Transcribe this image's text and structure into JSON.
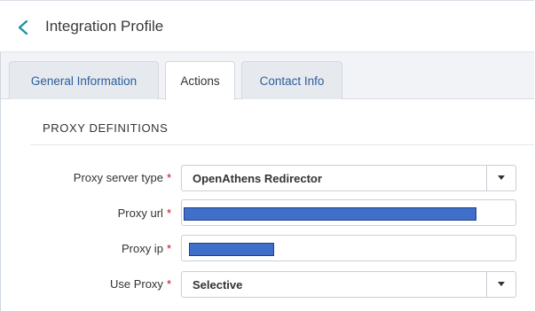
{
  "header": {
    "title": "Integration Profile"
  },
  "tabs": [
    {
      "label": "General Information",
      "active": false
    },
    {
      "label": "Actions",
      "active": true
    },
    {
      "label": "Contact Info",
      "active": false
    }
  ],
  "section": {
    "title": "PROXY DEFINITIONS"
  },
  "form": {
    "proxy_server_type": {
      "label": "Proxy server type",
      "value": "OpenAthens Redirector"
    },
    "proxy_url": {
      "label": "Proxy url"
    },
    "proxy_ip": {
      "label": "Proxy ip"
    },
    "use_proxy": {
      "label": "Use Proxy",
      "value": "Selective"
    },
    "required_mark": "*"
  },
  "colors": {
    "accent": "#2a5f9e",
    "required": "#d0021b",
    "redaction": "#3f6fc9"
  }
}
